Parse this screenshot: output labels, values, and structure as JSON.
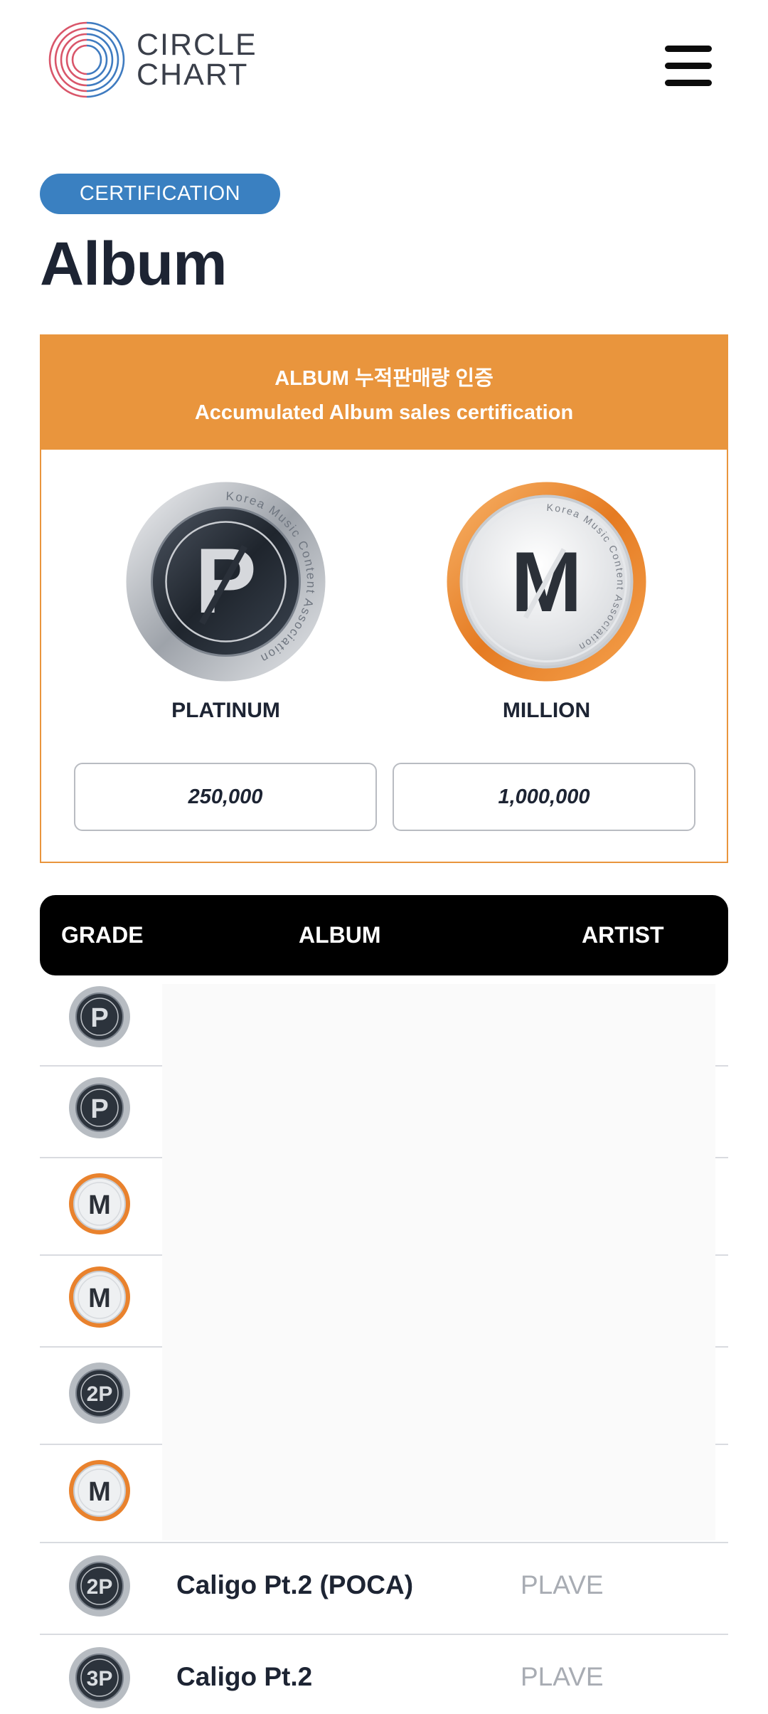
{
  "header": {
    "logo_line1": "CIRCLE",
    "logo_line2": "CHART",
    "menu_icon": "hamburger-menu-icon"
  },
  "page": {
    "category": "CERTIFICATION",
    "title": "Album"
  },
  "certification": {
    "heading_ko": "ALBUM 누적판매량 인증",
    "heading_en": "Accumulated Album sales certification",
    "levels": [
      {
        "name": "PLATINUM",
        "letter": "P",
        "threshold": "250,000",
        "ring_text": "Korea Music Content Association",
        "icon": "platinum-badge-icon"
      },
      {
        "name": "MILLION",
        "letter": "M",
        "threshold": "1,000,000",
        "ring_text": "Korea Music Content Association",
        "icon": "million-badge-icon"
      }
    ]
  },
  "table": {
    "columns": [
      "GRADE",
      "ALBUM",
      "ARTIST"
    ],
    "rows": [
      {
        "grade": "P",
        "album": "",
        "artist": ""
      },
      {
        "grade": "P",
        "album": "",
        "artist": ""
      },
      {
        "grade": "M",
        "album": "",
        "artist": ""
      },
      {
        "grade": "M",
        "album": "",
        "artist": ""
      },
      {
        "grade": "2P",
        "album": "",
        "artist": ""
      },
      {
        "grade": "M",
        "album": "",
        "artist": ""
      },
      {
        "grade": "2P",
        "album": "Caligo Pt.2 (POCA)",
        "artist": "PLAVE"
      },
      {
        "grade": "3P",
        "album": "Caligo Pt.2",
        "artist": "PLAVE"
      }
    ]
  },
  "colors": {
    "accent_blue": "#3a80c1",
    "cert_orange": "#e9953d",
    "title_navy": "#1d2433",
    "artist_gray": "#a8acb3"
  }
}
